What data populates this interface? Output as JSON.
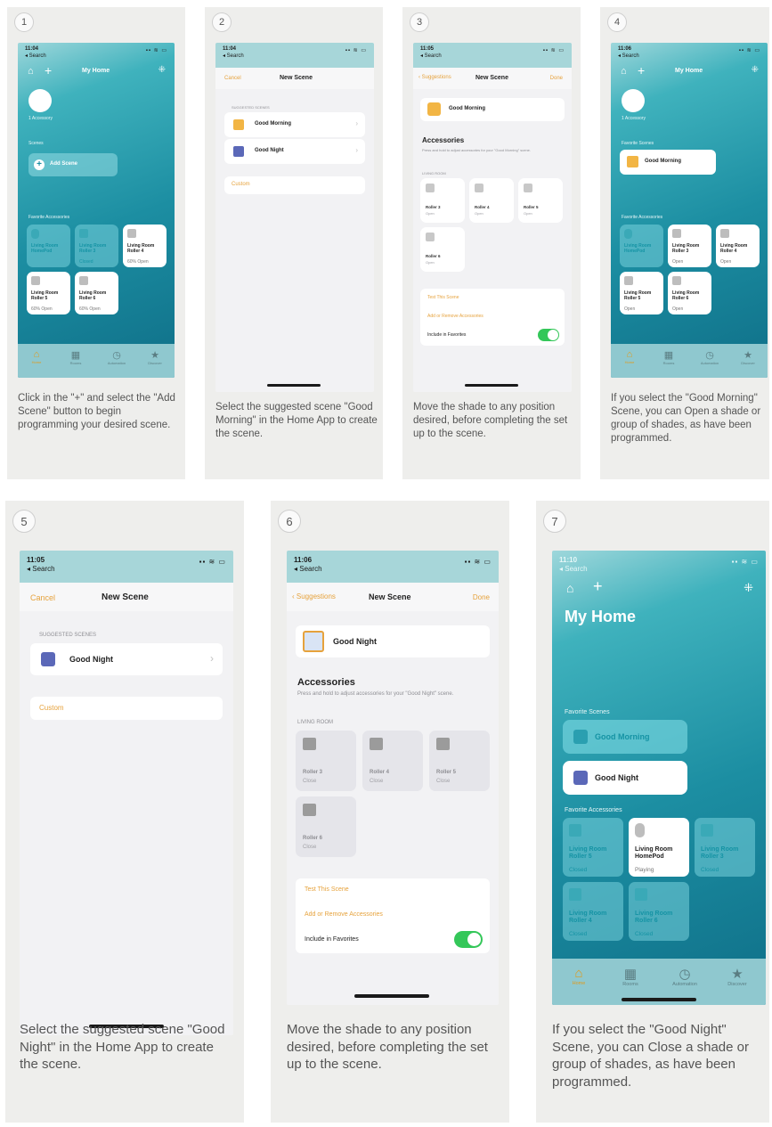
{
  "steps": [
    {
      "num": "1",
      "caption": "Click in the \"+\" and select the \"Add Scene\" button to begin programming your desired scene."
    },
    {
      "num": "2",
      "caption": "Select the suggested scene \"Good Morning\" in the Home App to create the scene."
    },
    {
      "num": "3",
      "caption": "Move the shade to any position desired, before completing the set up to the scene."
    },
    {
      "num": "4",
      "caption": "If you select the \"Good Morning\" Scene, you can Open a shade or group of shades, as have been programmed."
    },
    {
      "num": "5",
      "caption": "Select the suggested scene \"Good Night\" in the Home App to create the scene."
    },
    {
      "num": "6",
      "caption": "Move the shade to any position desired, before completing the set up to the scene."
    },
    {
      "num": "7",
      "caption": "If you select the \"Good Night\" Scene, you can Close a shade or group of shades, as have been programmed."
    }
  ],
  "s1": {
    "time": "11:04",
    "back": "◂ Search",
    "title": "My Home",
    "room_label": "1 Accessory",
    "scenes_label": "Scenes",
    "add_scene": "Add Scene",
    "fav_label": "Favorite Accessories",
    "tiles": [
      {
        "name": "Living Room HomePod",
        "status": ""
      },
      {
        "name": "Living Room Roller 3",
        "status": "Closed"
      },
      {
        "name": "Living Room Roller 4",
        "status": "60% Open"
      },
      {
        "name": "Living Room Roller 5",
        "status": "60% Open"
      },
      {
        "name": "Living Room Roller 6",
        "status": "60% Open"
      }
    ],
    "tabs": [
      "Home",
      "Rooms",
      "Automation",
      "Discover"
    ]
  },
  "s2": {
    "time": "11:04",
    "back": "◂ Search",
    "cancel": "Cancel",
    "title": "New Scene",
    "suggested": "SUGGESTED SCENES",
    "good_morning": "Good Morning",
    "good_night": "Good Night",
    "custom": "Custom"
  },
  "s3": {
    "time": "11:05",
    "back": "◂ Search",
    "back_nav": "Suggestions",
    "title": "New Scene",
    "done": "Done",
    "scene_name": "Good Morning",
    "accessories": "Accessories",
    "desc": "Press and hold to adjust accessories for your \"Good Morning\" scene.",
    "room": "LIVING ROOM",
    "tiles": [
      {
        "name": "Roller 3",
        "status": "Open"
      },
      {
        "name": "Roller 4",
        "status": "Open"
      },
      {
        "name": "Roller 5",
        "status": "Open"
      },
      {
        "name": "Roller 6",
        "status": "Open"
      }
    ],
    "test": "Test This Scene",
    "add_remove": "Add or Remove Accessories",
    "include_fav": "Include in Favorites"
  },
  "s4": {
    "time": "11:06",
    "back": "◂ Search",
    "title": "My Home",
    "room_label": "1 Accessory",
    "fav_scenes": "Favorite Scenes",
    "scene": "Good Morning",
    "fav_label": "Favorite Accessories",
    "tiles": [
      {
        "name": "Living Room HomePod",
        "status": ""
      },
      {
        "name": "Living Room Roller 3",
        "status": "Open"
      },
      {
        "name": "Living Room Roller 4",
        "status": "Open"
      },
      {
        "name": "Living Room Roller 5",
        "status": "Open"
      },
      {
        "name": "Living Room Roller 6",
        "status": "Open"
      }
    ],
    "tabs": [
      "Home",
      "Rooms",
      "Automation",
      "Discover"
    ]
  },
  "s5": {
    "time": "11:05",
    "back": "◂ Search",
    "cancel": "Cancel",
    "title": "New Scene",
    "suggested": "SUGGESTED SCENES",
    "good_night": "Good Night",
    "custom": "Custom"
  },
  "s6": {
    "time": "11:06",
    "back": "◂ Search",
    "back_nav": "Suggestions",
    "title": "New Scene",
    "done": "Done",
    "scene_name": "Good Night",
    "accessories": "Accessories",
    "desc": "Press and hold to adjust accessories for your \"Good Night\" scene.",
    "room": "LIVING ROOM",
    "tiles": [
      {
        "name": "Roller 3",
        "status": "Close"
      },
      {
        "name": "Roller 4",
        "status": "Close"
      },
      {
        "name": "Roller 5",
        "status": "Close"
      },
      {
        "name": "Roller 6",
        "status": "Close"
      }
    ],
    "test": "Test This Scene",
    "add_remove": "Add or Remove Accessories",
    "include_fav": "Include in Favorites"
  },
  "s7": {
    "time": "11:10",
    "back": "◂ Search",
    "title": "My Home",
    "fav_scenes": "Favorite Scenes",
    "scene_morning": "Good Morning",
    "scene_night": "Good Night",
    "fav_label": "Favorite Accessories",
    "tiles": [
      {
        "name": "Living Room Roller 5",
        "status": "Closed"
      },
      {
        "name": "Living Room HomePod",
        "status": "Playing"
      },
      {
        "name": "Living Room Roller 3",
        "status": "Closed"
      },
      {
        "name": "Living Room Roller 4",
        "status": "Closed"
      },
      {
        "name": "Living Room Roller 6",
        "status": "Closed"
      }
    ],
    "tabs": [
      "Home",
      "Rooms",
      "Automation",
      "Discover"
    ]
  },
  "colors": {
    "accent": "#e6a23c",
    "teal": "#1c8ea2",
    "toggle_on": "#34c759"
  },
  "icons": {
    "home": "home-icon",
    "add": "plus-icon",
    "settings": "waveform-icon",
    "chevron": "chevron-right-icon",
    "scene_morning": "sunrise-house-icon",
    "scene_night": "moon-house-icon"
  }
}
